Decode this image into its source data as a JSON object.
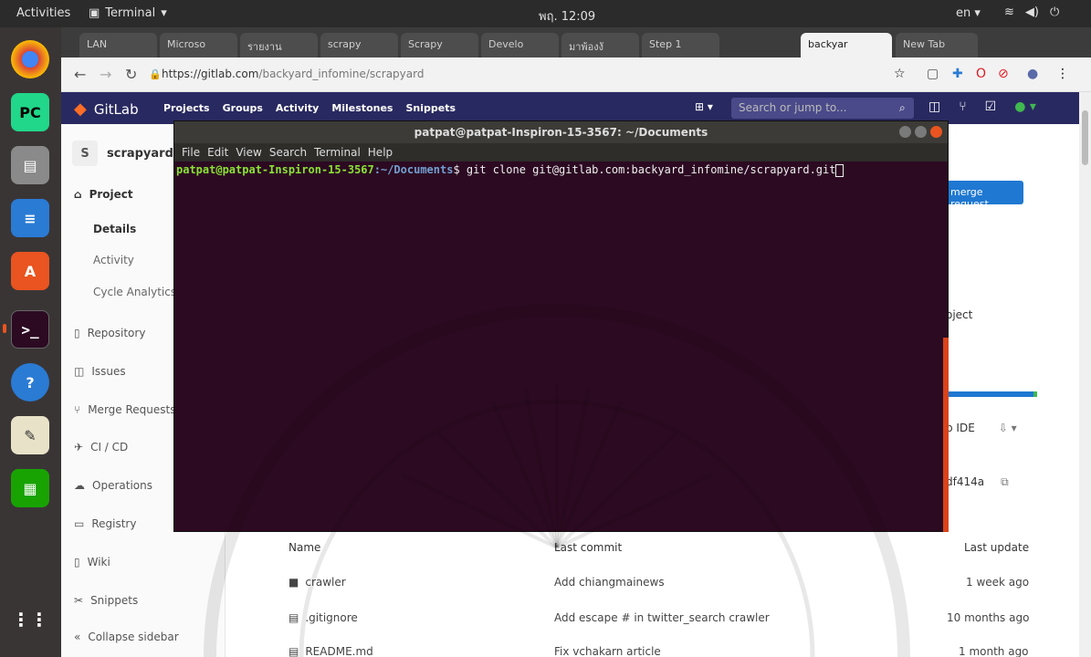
{
  "topbar": {
    "activities": "Activities",
    "app": "Terminal",
    "clock": "พฤ. 12:09",
    "lang": "en"
  },
  "browser": {
    "tabs": [
      "LAN",
      "Microso",
      "รายงาน",
      "scrapy",
      "Scrapy",
      "Develo",
      "มาพ้องงั",
      "Step 1",
      "backyar",
      "New Tab"
    ],
    "url_host": "https://gitlab.com",
    "url_path": "/backyard_infomine/scrapyard"
  },
  "gitlab": {
    "brand": "GitLab",
    "nav": [
      "Projects",
      "Groups",
      "Activity",
      "Milestones",
      "Snippets"
    ],
    "search_placeholder": "Search or jump to..."
  },
  "sidebar": {
    "avatar": "S",
    "project": "scrapyard",
    "items": [
      "Project",
      "Details",
      "Activity",
      "Cycle Analytics",
      "Repository",
      "Issues",
      "Merge Requests",
      "CI / CD",
      "Operations",
      "Registry",
      "Wiki",
      "Snippets",
      "Collapse sidebar"
    ]
  },
  "main": {
    "merge_button": "merge request",
    "project_text": "oject",
    "ide": "b IDE",
    "hash": "df414a",
    "table_headers": {
      "name": "Name",
      "last_commit": "Last commit",
      "last_update": "Last update"
    },
    "rows": [
      {
        "name": "crawler",
        "commit": "Add chiangmainews",
        "date": "1 week ago"
      },
      {
        "name": ".gitignore",
        "commit": "Add escape # in twitter_search crawler",
        "date": "10 months ago"
      },
      {
        "name": "README.md",
        "commit": "Fix vchakarn article",
        "date": "1 month ago"
      }
    ]
  },
  "terminal": {
    "title": "patpat@patpat-Inspiron-15-3567: ~/Documents",
    "menu": [
      "File",
      "Edit",
      "View",
      "Search",
      "Terminal",
      "Help"
    ],
    "user": "patpat@patpat-Inspiron-15-3567",
    "path": ":~/Documents",
    "command": "$ git clone git@gitlab.com:backyard_infomine/scrapyard.git"
  },
  "colors": {
    "gitlab_header": "#292961",
    "terminal_bg": "#2c0a22",
    "accent": "#e95420",
    "primary": "#1f78d1"
  }
}
